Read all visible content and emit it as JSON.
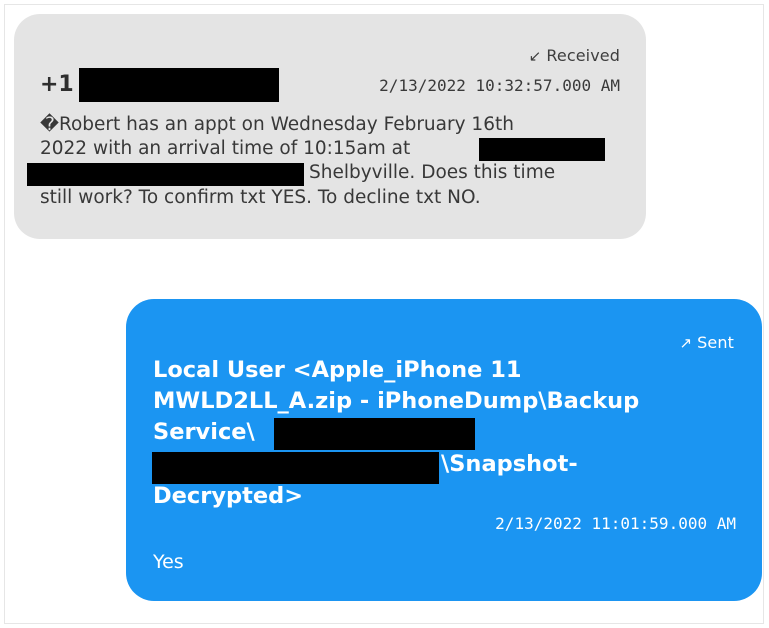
{
  "conversation": {
    "received": {
      "direction_icon": "arrow-down-left",
      "direction_label": "Received",
      "sender_prefix": "+1",
      "timestamp": "2/13/2022 10:32:57.000 AM",
      "body_lines": [
        "�Robert has an appt on Wednesday February 16th",
        "2022 with an arrival time of 10:15am at",
        "Shelbyville. Does this time",
        "still work? To confirm txt YES. To decline txt NO."
      ]
    },
    "sent": {
      "direction_icon": "arrow-up-right",
      "direction_label": "Sent",
      "header_lines": [
        "Local User <Apple_iPhone 11",
        "MWLD2LL_A.zip - iPhoneDump\\Backup",
        "Service\\",
        "\\Snapshot-",
        "Decrypted>"
      ],
      "timestamp": "2/13/2022 11:01:59.000 AM",
      "body": "Yes"
    }
  }
}
